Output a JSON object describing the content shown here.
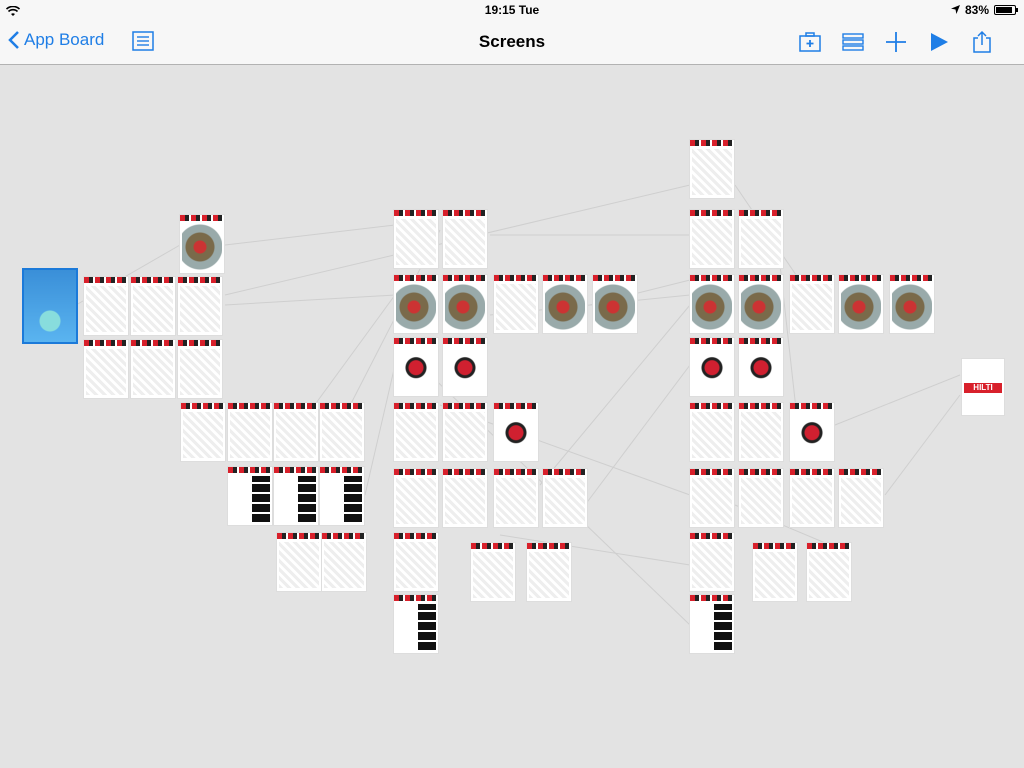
{
  "status": {
    "time": "19:15 Tue",
    "battery": "83%",
    "battery_level": 0.83
  },
  "nav": {
    "back_label": "App Board",
    "title": "Screens"
  },
  "colors": {
    "accent": "#1f7ee6",
    "brand": "#d8202b"
  },
  "icons": [
    "wifi-icon",
    "location-arrow-icon",
    "battery-icon",
    "chevron-left-icon",
    "list-view-icon",
    "medical-kit-icon",
    "stack-icon",
    "plus-icon",
    "play-icon",
    "share-icon"
  ],
  "hilti_logo": "HILTI"
}
